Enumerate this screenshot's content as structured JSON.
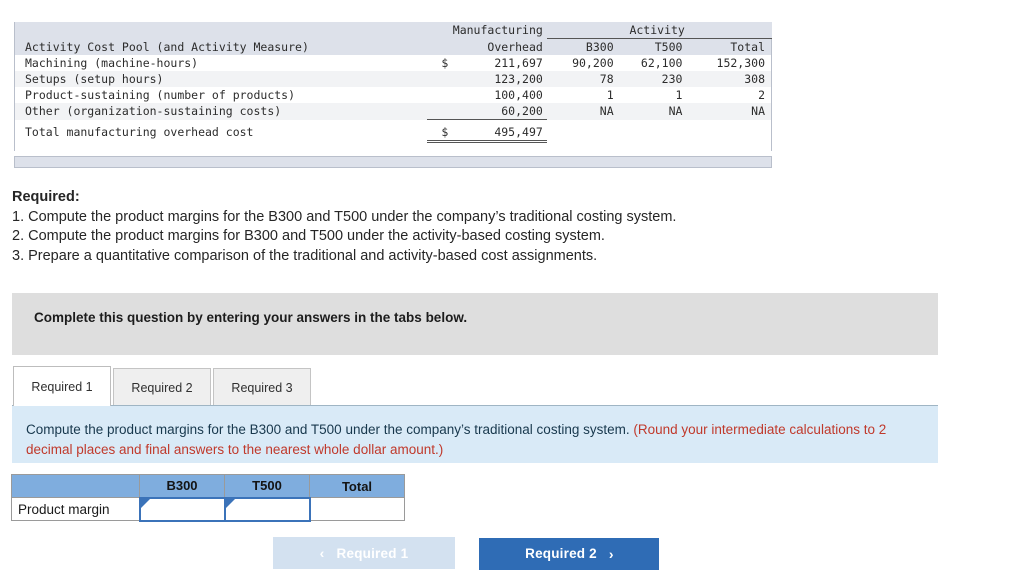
{
  "cost_table": {
    "group_header": "Activity",
    "col_headers": {
      "label": "Activity Cost Pool (and Activity Measure)",
      "mfg_line1": "Manufacturing",
      "mfg_line2": "Overhead",
      "b300": "B300",
      "t500": "T500",
      "total": "Total"
    },
    "rows": [
      {
        "label": "Machining (machine-hours)",
        "dollar": "$",
        "mfg": "211,697",
        "b300": "90,200",
        "t500": "62,100",
        "total": "152,300"
      },
      {
        "label": "Setups (setup hours)",
        "dollar": "",
        "mfg": "123,200",
        "b300": "78",
        "t500": "230",
        "total": "308"
      },
      {
        "label": "Product-sustaining (number of products)",
        "dollar": "",
        "mfg": "100,400",
        "b300": "1",
        "t500": "1",
        "total": "2"
      },
      {
        "label": "Other (organization-sustaining costs)",
        "dollar": "",
        "mfg": "60,200",
        "b300": "NA",
        "t500": "NA",
        "total": "NA"
      }
    ],
    "total_row": {
      "label": "Total manufacturing overhead cost",
      "dollar": "$",
      "mfg": "495,497"
    }
  },
  "required": {
    "title": "Required:",
    "items": [
      "1. Compute the product margins for the B300 and T500 under the company’s traditional costing system.",
      "2. Compute the product margins for B300 and T500 under the activity-based costing system.",
      "3. Prepare a quantitative comparison of the traditional and activity-based cost assignments."
    ]
  },
  "instruction_panel": {
    "text": "Complete this question by entering your answers in the tabs below."
  },
  "tabs": [
    {
      "label": "Required 1",
      "active": true
    },
    {
      "label": "Required 2",
      "active": false
    },
    {
      "label": "Required 3",
      "active": false
    }
  ],
  "question_panel": {
    "main_text": "Compute the product margins for the B300 and T500 under the company’s traditional costing system. ",
    "hint_text": "(Round your intermediate calculations to 2 decimal places and final answers to the nearest whole dollar amount.)"
  },
  "answer_table": {
    "headers": {
      "corner": "",
      "b300": "B300",
      "t500": "T500",
      "total": "Total"
    },
    "row_label": "Product margin",
    "values": {
      "b300": "",
      "t500": "",
      "total": ""
    }
  },
  "nav": {
    "prev_label": "Required 1",
    "prev_chevron": "‹",
    "next_label": "Required 2",
    "next_chevron": "›"
  },
  "colors": {
    "table_header_band": "#dde1ea",
    "row_alt": "#f2f3f5",
    "gray_panel": "#dedede",
    "blue_panel": "#d9eaf7",
    "answer_header_blue": "#7fadde",
    "input_border_blue": "#3b73b9",
    "next_button_blue": "#2f6cb5",
    "prev_button_blue": "#d3e1f0",
    "hint_red": "#c0392b"
  }
}
